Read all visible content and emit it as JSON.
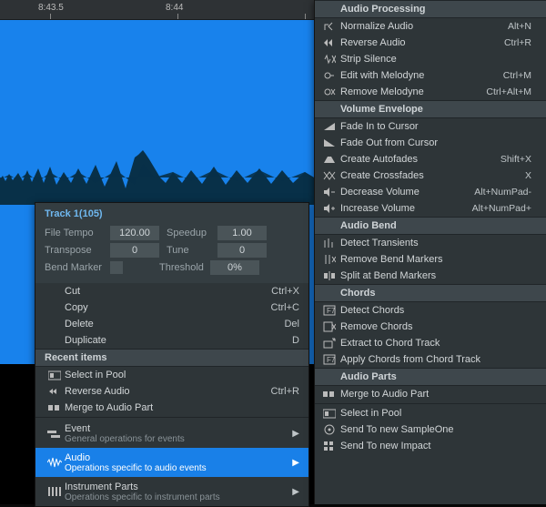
{
  "timeline": {
    "mark_left": "8:43.5",
    "mark_right": "8:44"
  },
  "props": {
    "title": "Track 1(105)",
    "rows": {
      "file_tempo_label": "File Tempo",
      "file_tempo": "120.00",
      "speedup_label": "Speedup",
      "speedup": "1.00",
      "transpose_label": "Transpose",
      "transpose": "0",
      "tune_label": "Tune",
      "tune": "0",
      "bend_marker_label": "Bend Marker",
      "threshold_label": "Threshold",
      "threshold": "0%"
    }
  },
  "menu1": {
    "cut": "Cut",
    "cut_sc": "Ctrl+X",
    "copy": "Copy",
    "copy_sc": "Ctrl+C",
    "delete": "Delete",
    "delete_sc": "Del",
    "duplicate": "Duplicate",
    "duplicate_sc": "D",
    "header_recent": "Recent items",
    "select_pool": "Select in Pool",
    "reverse": "Reverse Audio",
    "reverse_sc": "Ctrl+R",
    "merge": "Merge to Audio Part",
    "event": "Event",
    "event_desc": "General operations for events",
    "audio": "Audio",
    "audio_desc": "Operations specific to audio events",
    "instr": "Instrument Parts",
    "instr_desc": "Operations specific to instrument parts"
  },
  "menu2": {
    "h_proc": "Audio Processing",
    "normalize": "Normalize Audio",
    "normalize_sc": "Alt+N",
    "reverse": "Reverse Audio",
    "reverse_sc": "Ctrl+R",
    "strip": "Strip Silence",
    "edit_mel": "Edit with Melodyne",
    "edit_mel_sc": "Ctrl+M",
    "remove_mel": "Remove Melodyne",
    "remove_mel_sc": "Ctrl+Alt+M",
    "h_env": "Volume Envelope",
    "fade_in": "Fade In to Cursor",
    "fade_out": "Fade Out from Cursor",
    "autofades": "Create Autofades",
    "autofades_sc": "Shift+X",
    "crossfades": "Create Crossfades",
    "crossfades_sc": "X",
    "dec_vol": "Decrease Volume",
    "dec_vol_sc": "Alt+NumPad-",
    "inc_vol": "Increase Volume",
    "inc_vol_sc": "Alt+NumPad+",
    "h_bend": "Audio Bend",
    "detect_tr": "Detect Transients",
    "remove_bm": "Remove Bend Markers",
    "split_bm": "Split at Bend Markers",
    "h_chords": "Chords",
    "detect_ch": "Detect Chords",
    "remove_ch": "Remove Chords",
    "extract_ch": "Extract to Chord Track",
    "apply_ch": "Apply Chords from Chord Track",
    "h_parts": "Audio Parts",
    "merge2": "Merge to Audio Part",
    "select_pool2": "Select in Pool",
    "send_so": "Send To new SampleOne",
    "send_imp": "Send To new Impact"
  }
}
